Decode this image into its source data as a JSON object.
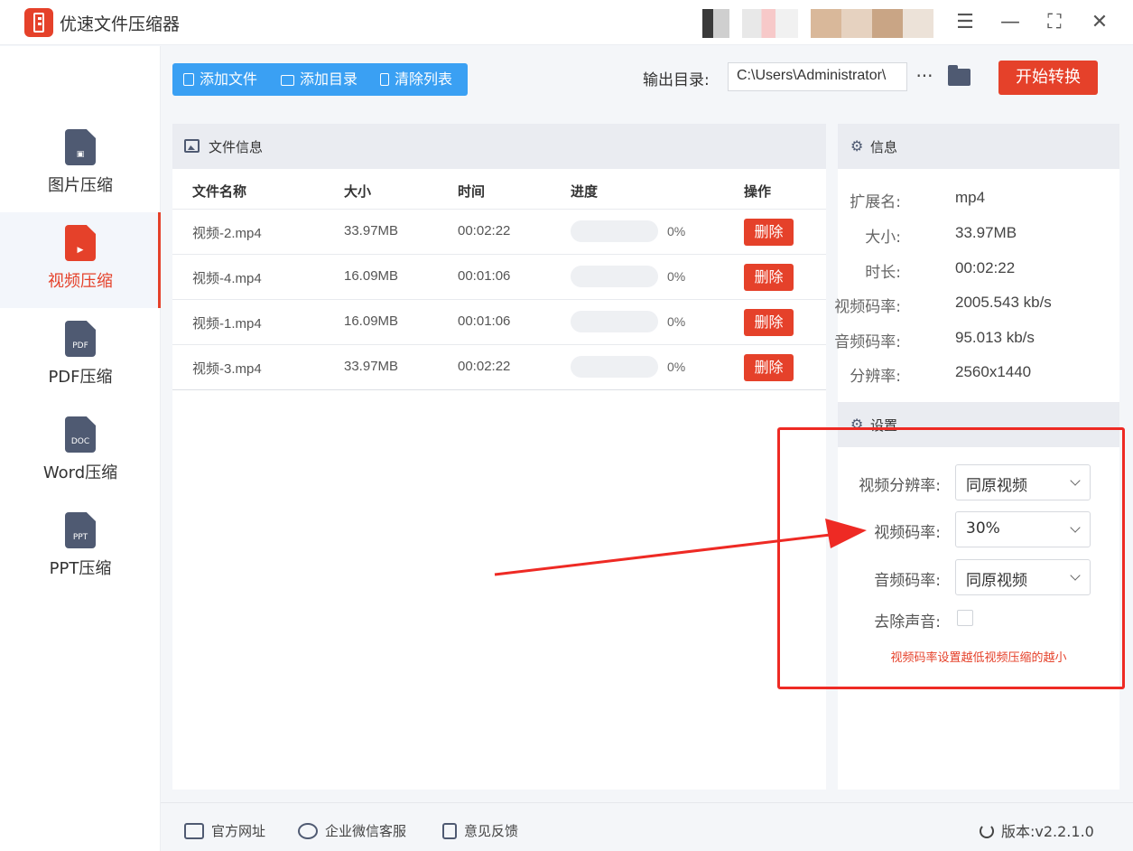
{
  "window": {
    "title": "优速文件压缩器",
    "controls": {
      "menu": "☰",
      "minimize": "—",
      "maximize": "⛶",
      "close": "✕"
    }
  },
  "sidebar": {
    "items": [
      {
        "label": "图片压缩",
        "glyph": "▣",
        "active": false
      },
      {
        "label": "视频压缩",
        "glyph": "▶",
        "active": true
      },
      {
        "label": "PDF压缩",
        "glyph": "PDF",
        "active": false
      },
      {
        "label": "Word压缩",
        "glyph": "DOC",
        "active": false
      },
      {
        "label": "PPT压缩",
        "glyph": "PPT",
        "active": false
      }
    ]
  },
  "toolbar": {
    "add_file": "添加文件",
    "add_dir": "添加目录",
    "clear_list": "清除列表",
    "output_label": "输出目录:",
    "output_path": "C:\\Users\\Administrator\\",
    "more": "···",
    "start": "开始转换"
  },
  "file_panel": {
    "title": "文件信息",
    "columns": [
      "文件名称",
      "大小",
      "时间",
      "进度",
      "操作"
    ],
    "rows": [
      {
        "name": "视频-2.mp4",
        "size": "33.97MB",
        "time": "00:02:22",
        "progress": 0,
        "progress_text": "0%",
        "action": "删除"
      },
      {
        "name": "视频-4.mp4",
        "size": "16.09MB",
        "time": "00:01:06",
        "progress": 0,
        "progress_text": "0%",
        "action": "删除"
      },
      {
        "name": "视频-1.mp4",
        "size": "16.09MB",
        "time": "00:01:06",
        "progress": 0,
        "progress_text": "0%",
        "action": "删除"
      },
      {
        "name": "视频-3.mp4",
        "size": "33.97MB",
        "time": "00:02:22",
        "progress": 0,
        "progress_text": "0%",
        "action": "删除"
      }
    ]
  },
  "info": {
    "title": "信息",
    "fields": [
      {
        "label": "扩展名:",
        "value": "mp4"
      },
      {
        "label": "大小:",
        "value": "33.97MB"
      },
      {
        "label": "时长:",
        "value": "00:02:22"
      },
      {
        "label": "视频码率:",
        "value": "2005.543 kb/s"
      },
      {
        "label": "音频码率:",
        "value": "95.013 kb/s"
      },
      {
        "label": "分辨率:",
        "value": "2560x1440"
      }
    ]
  },
  "settings": {
    "title": "设置",
    "video_resolution": {
      "label": "视频分辨率:",
      "value": "同原视频"
    },
    "video_bitrate": {
      "label": "视频码率:",
      "value": "30%"
    },
    "audio_bitrate": {
      "label": "音频码率:",
      "value": "同原视频"
    },
    "mute": {
      "label": "去除声音:",
      "checked": false
    },
    "hint": "视频码率设置越低视频压缩的越小"
  },
  "footer": {
    "website": "官方网址",
    "wechat_support": "企业微信客服",
    "feedback": "意见反馈",
    "version": "版本:v2.2.1.0"
  },
  "colors": {
    "accent": "#e5412a",
    "toolbar_blue": "#3aa0f3",
    "annotation_red": "#ee2a24",
    "icon_slate": "#4f5a72"
  }
}
